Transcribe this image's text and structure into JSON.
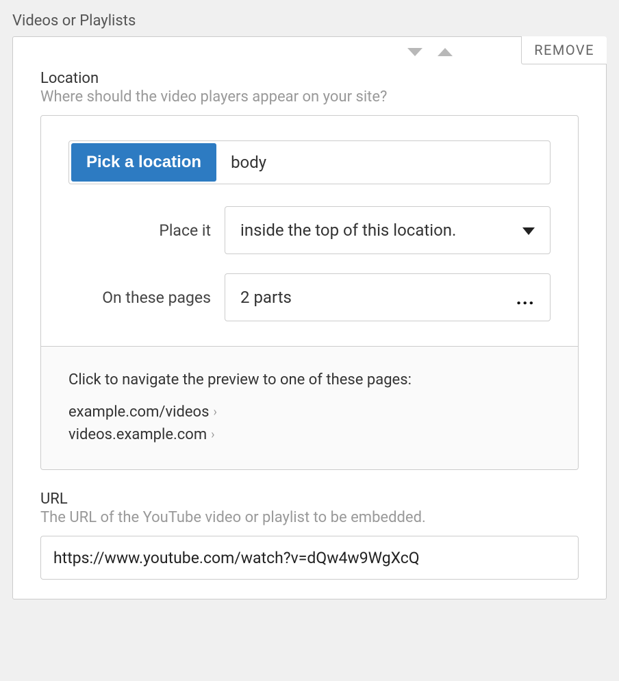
{
  "panel": {
    "title": "Videos or Playlists",
    "remove_label": "REMOVE"
  },
  "location": {
    "label": "Location",
    "description": "Where should the video players appear on your site?",
    "pick_button": "Pick a location",
    "current_location": "body",
    "place_label": "Place it",
    "place_value": "inside the top of this location.",
    "pages_label": "On these pages",
    "pages_value": "2 parts",
    "preview_instruction": "Click to navigate the preview to one of these pages:",
    "page_items": {
      "0": "example.com/videos",
      "1": "videos.example.com"
    }
  },
  "url": {
    "label": "URL",
    "description": "The URL of the YouTube video or playlist to be embedded.",
    "value": "https://www.youtube.com/watch?v=dQw4w9WgXcQ"
  }
}
